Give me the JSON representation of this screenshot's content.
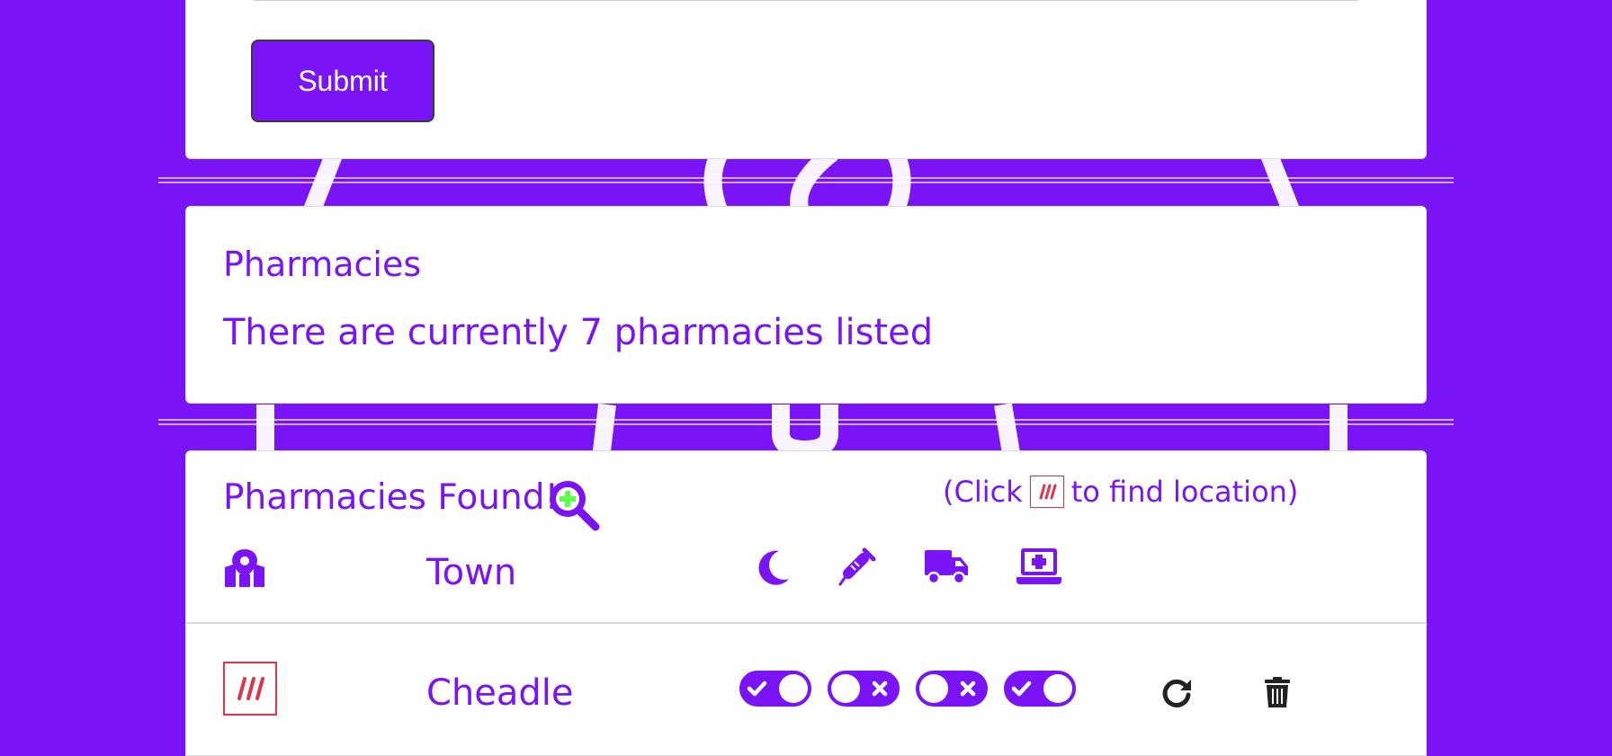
{
  "form": {
    "submit_label": "Submit"
  },
  "summary": {
    "title": "Pharmacies",
    "text": "There are currently 7 pharmacies listed"
  },
  "results": {
    "title": "Pharmacies Found!",
    "hint_prefix": "(Click",
    "hint_suffix": "to find location)",
    "town_header": "Town",
    "header_icons": [
      "map-marker-icon",
      "moon-icon",
      "syringe-icon",
      "truck-icon",
      "laptop-medical-icon"
    ],
    "rows": [
      {
        "town": "Cheadle",
        "toggles": [
          true,
          false,
          false,
          true
        ]
      }
    ]
  },
  "colors": {
    "brand": "#7a14f6",
    "location": "#e0344a",
    "zoom_plus": "#5dff4a",
    "action": "#222222"
  },
  "icons": {
    "zoom": "search-plus-icon",
    "refresh": "redo-icon",
    "delete": "trash-icon"
  }
}
